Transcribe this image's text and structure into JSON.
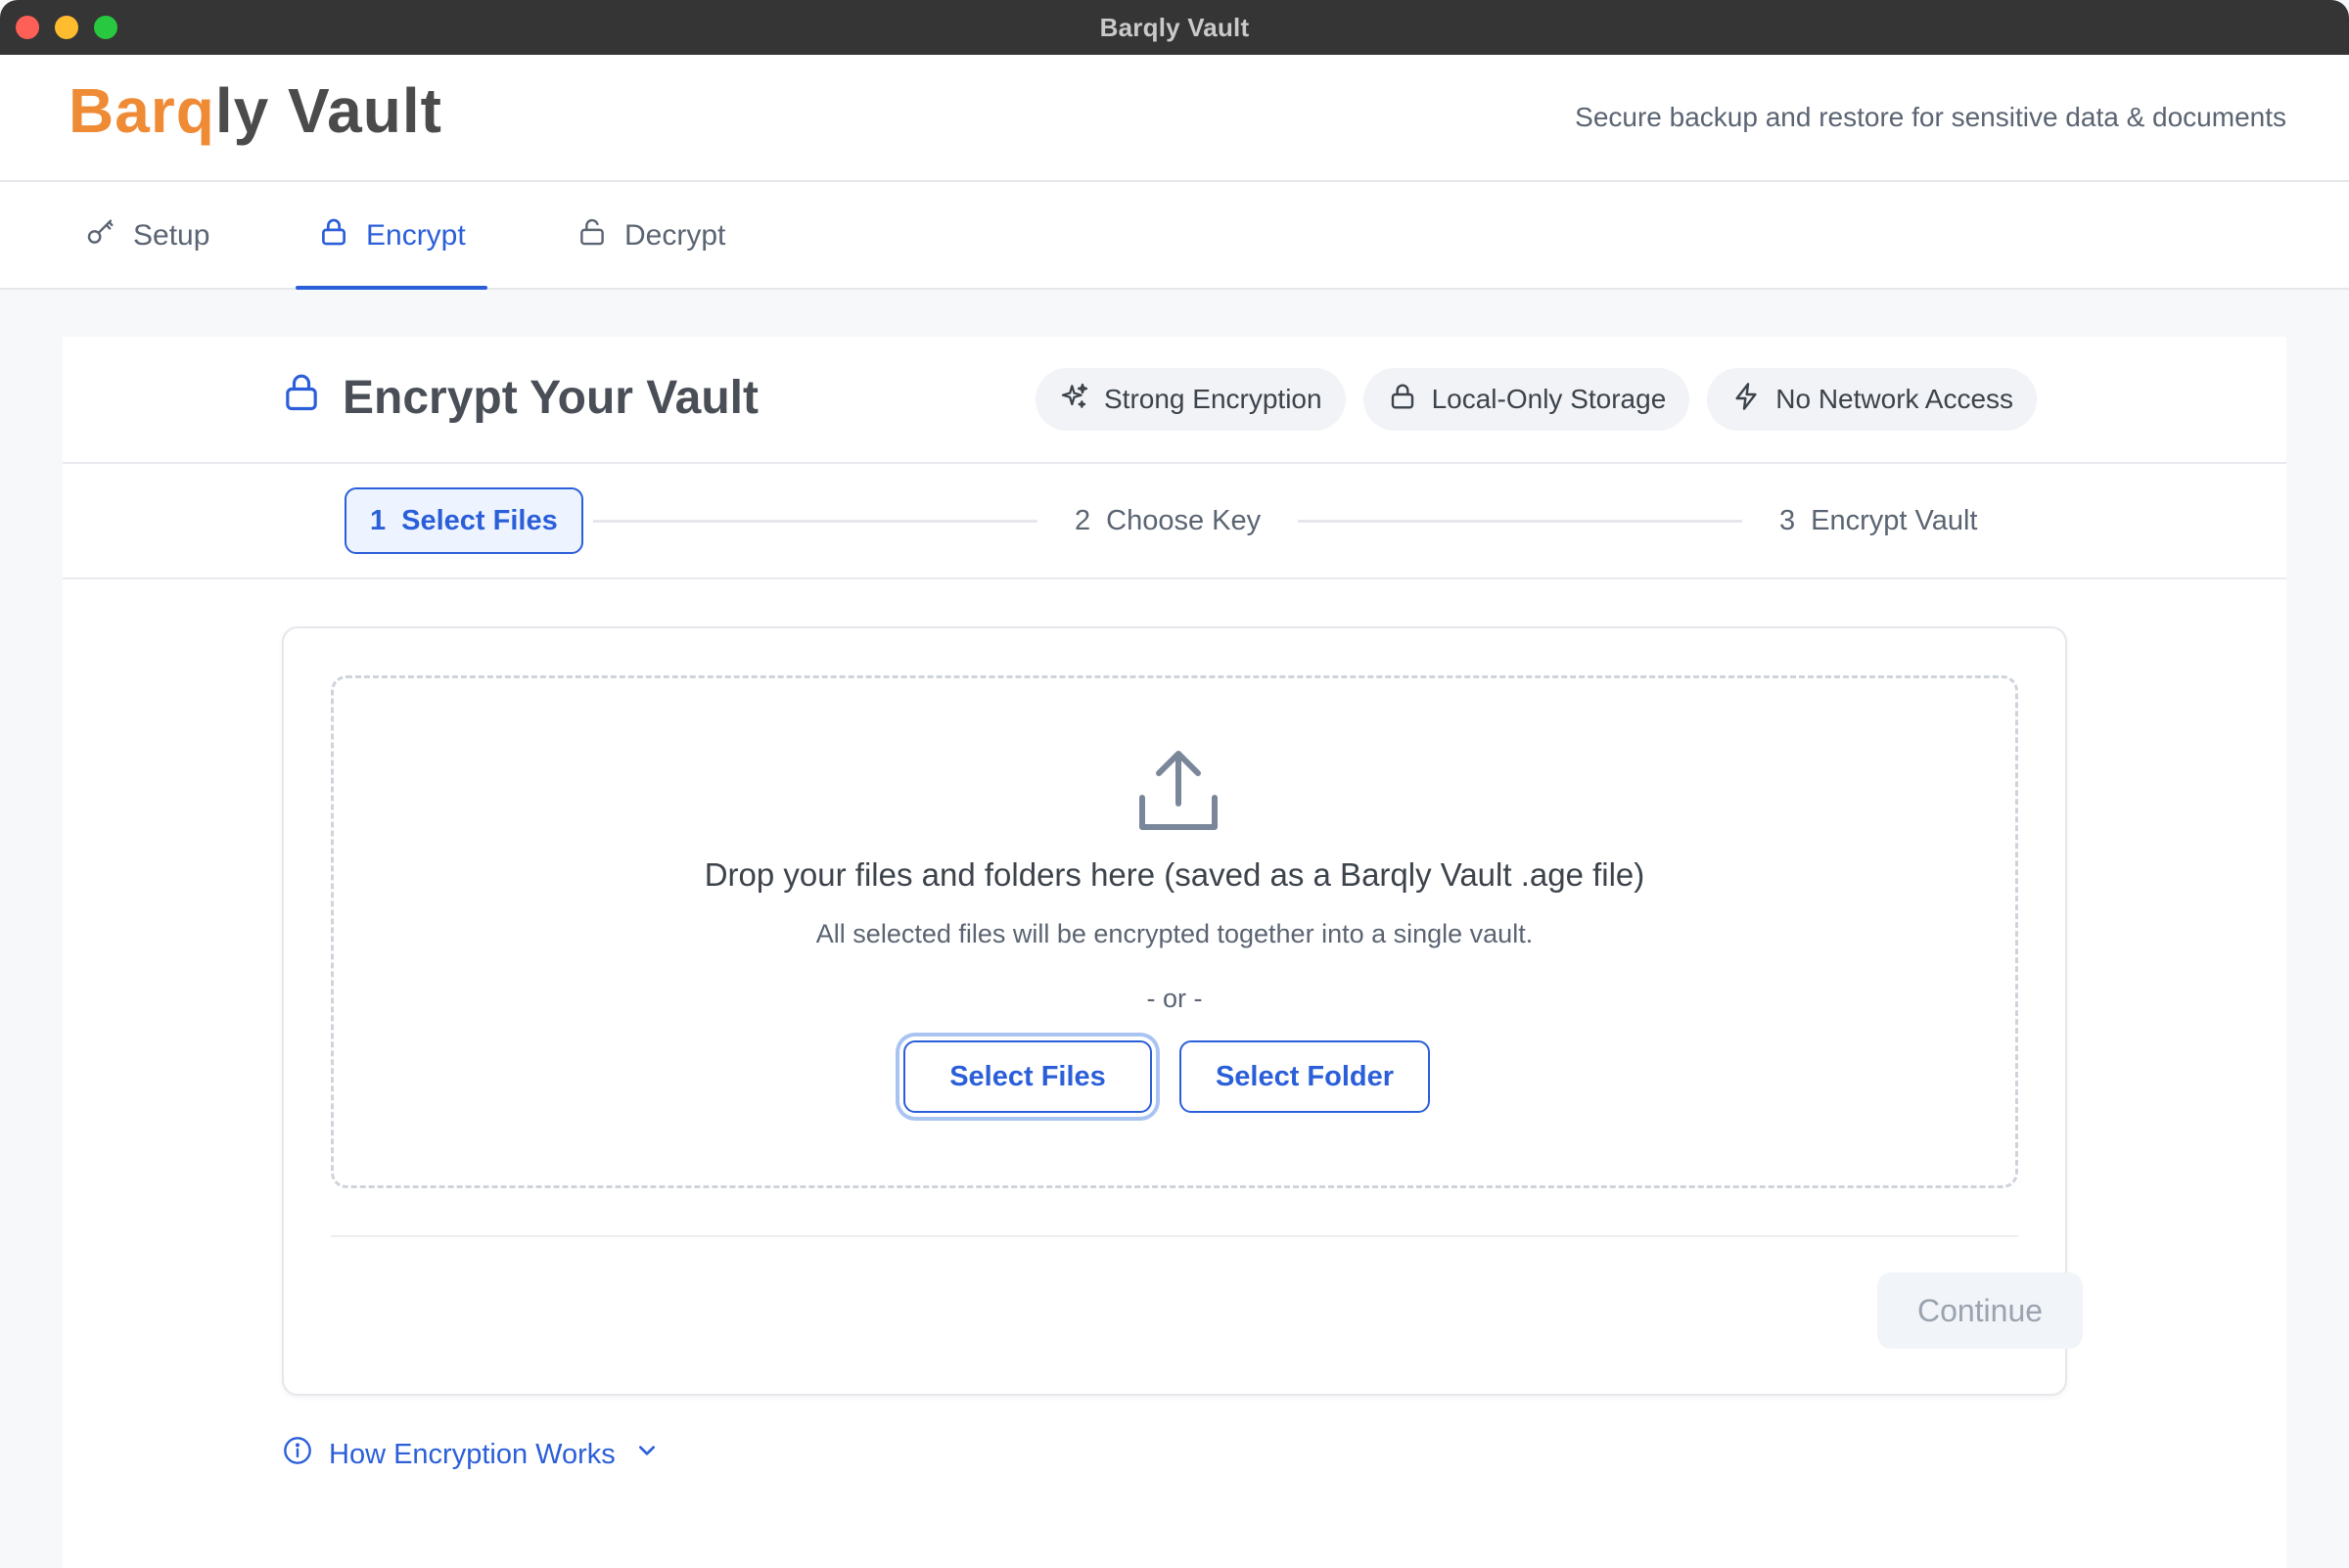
{
  "window": {
    "title": "Barqly Vault"
  },
  "header": {
    "logo_accent": "Barq",
    "logo_rest": "ly Vault",
    "tagline": "Secure backup and restore for sensitive data & documents"
  },
  "tabs": [
    {
      "label": "Setup",
      "icon": "key-icon",
      "active": false
    },
    {
      "label": "Encrypt",
      "icon": "lock-icon",
      "active": true
    },
    {
      "label": "Decrypt",
      "icon": "unlock-icon",
      "active": false
    }
  ],
  "page": {
    "title": "Encrypt Your Vault",
    "badges": [
      {
        "label": "Strong Encryption",
        "icon": "sparkles-icon"
      },
      {
        "label": "Local-Only Storage",
        "icon": "lock-icon"
      },
      {
        "label": "No Network Access",
        "icon": "lightning-icon"
      }
    ]
  },
  "stepper": {
    "steps": [
      {
        "number": "1",
        "label": "Select Files",
        "active": true
      },
      {
        "number": "2",
        "label": "Choose Key",
        "active": false
      },
      {
        "number": "3",
        "label": "Encrypt Vault",
        "active": false
      }
    ]
  },
  "dropzone": {
    "title": "Drop your files and folders here (saved as a Barqly Vault .age file)",
    "subtitle": "All selected files will be encrypted together into a single vault.",
    "or_text": "- or -",
    "select_files_label": "Select Files",
    "select_folder_label": "Select Folder"
  },
  "footer": {
    "continue_label": "Continue",
    "continue_enabled": false
  },
  "info": {
    "label": "How Encryption Works"
  },
  "colors": {
    "accent": "#2b5fd9",
    "brand_orange": "#ef8a35",
    "titlebar": "#353535"
  }
}
